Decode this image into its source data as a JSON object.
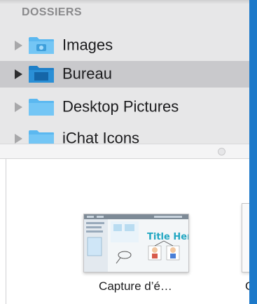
{
  "sidebar": {
    "header": "DOSSIERS",
    "items": [
      {
        "label": "Images",
        "icon": "pictures-folder-icon"
      },
      {
        "label": "Bureau",
        "icon": "desktop-folder-icon",
        "selected": true
      },
      {
        "label": "Desktop Pictures",
        "icon": "folder-icon"
      },
      {
        "label": "iChat Icons",
        "icon": "folder-icon"
      }
    ]
  },
  "files": [
    {
      "name": "Capture d’é…",
      "thumbnail_text": "Title Here"
    },
    {
      "name": "C"
    }
  ],
  "colors": {
    "accent": "#1d79c9",
    "folder": "#5bb8f0",
    "selection": "#c9c9cc"
  }
}
